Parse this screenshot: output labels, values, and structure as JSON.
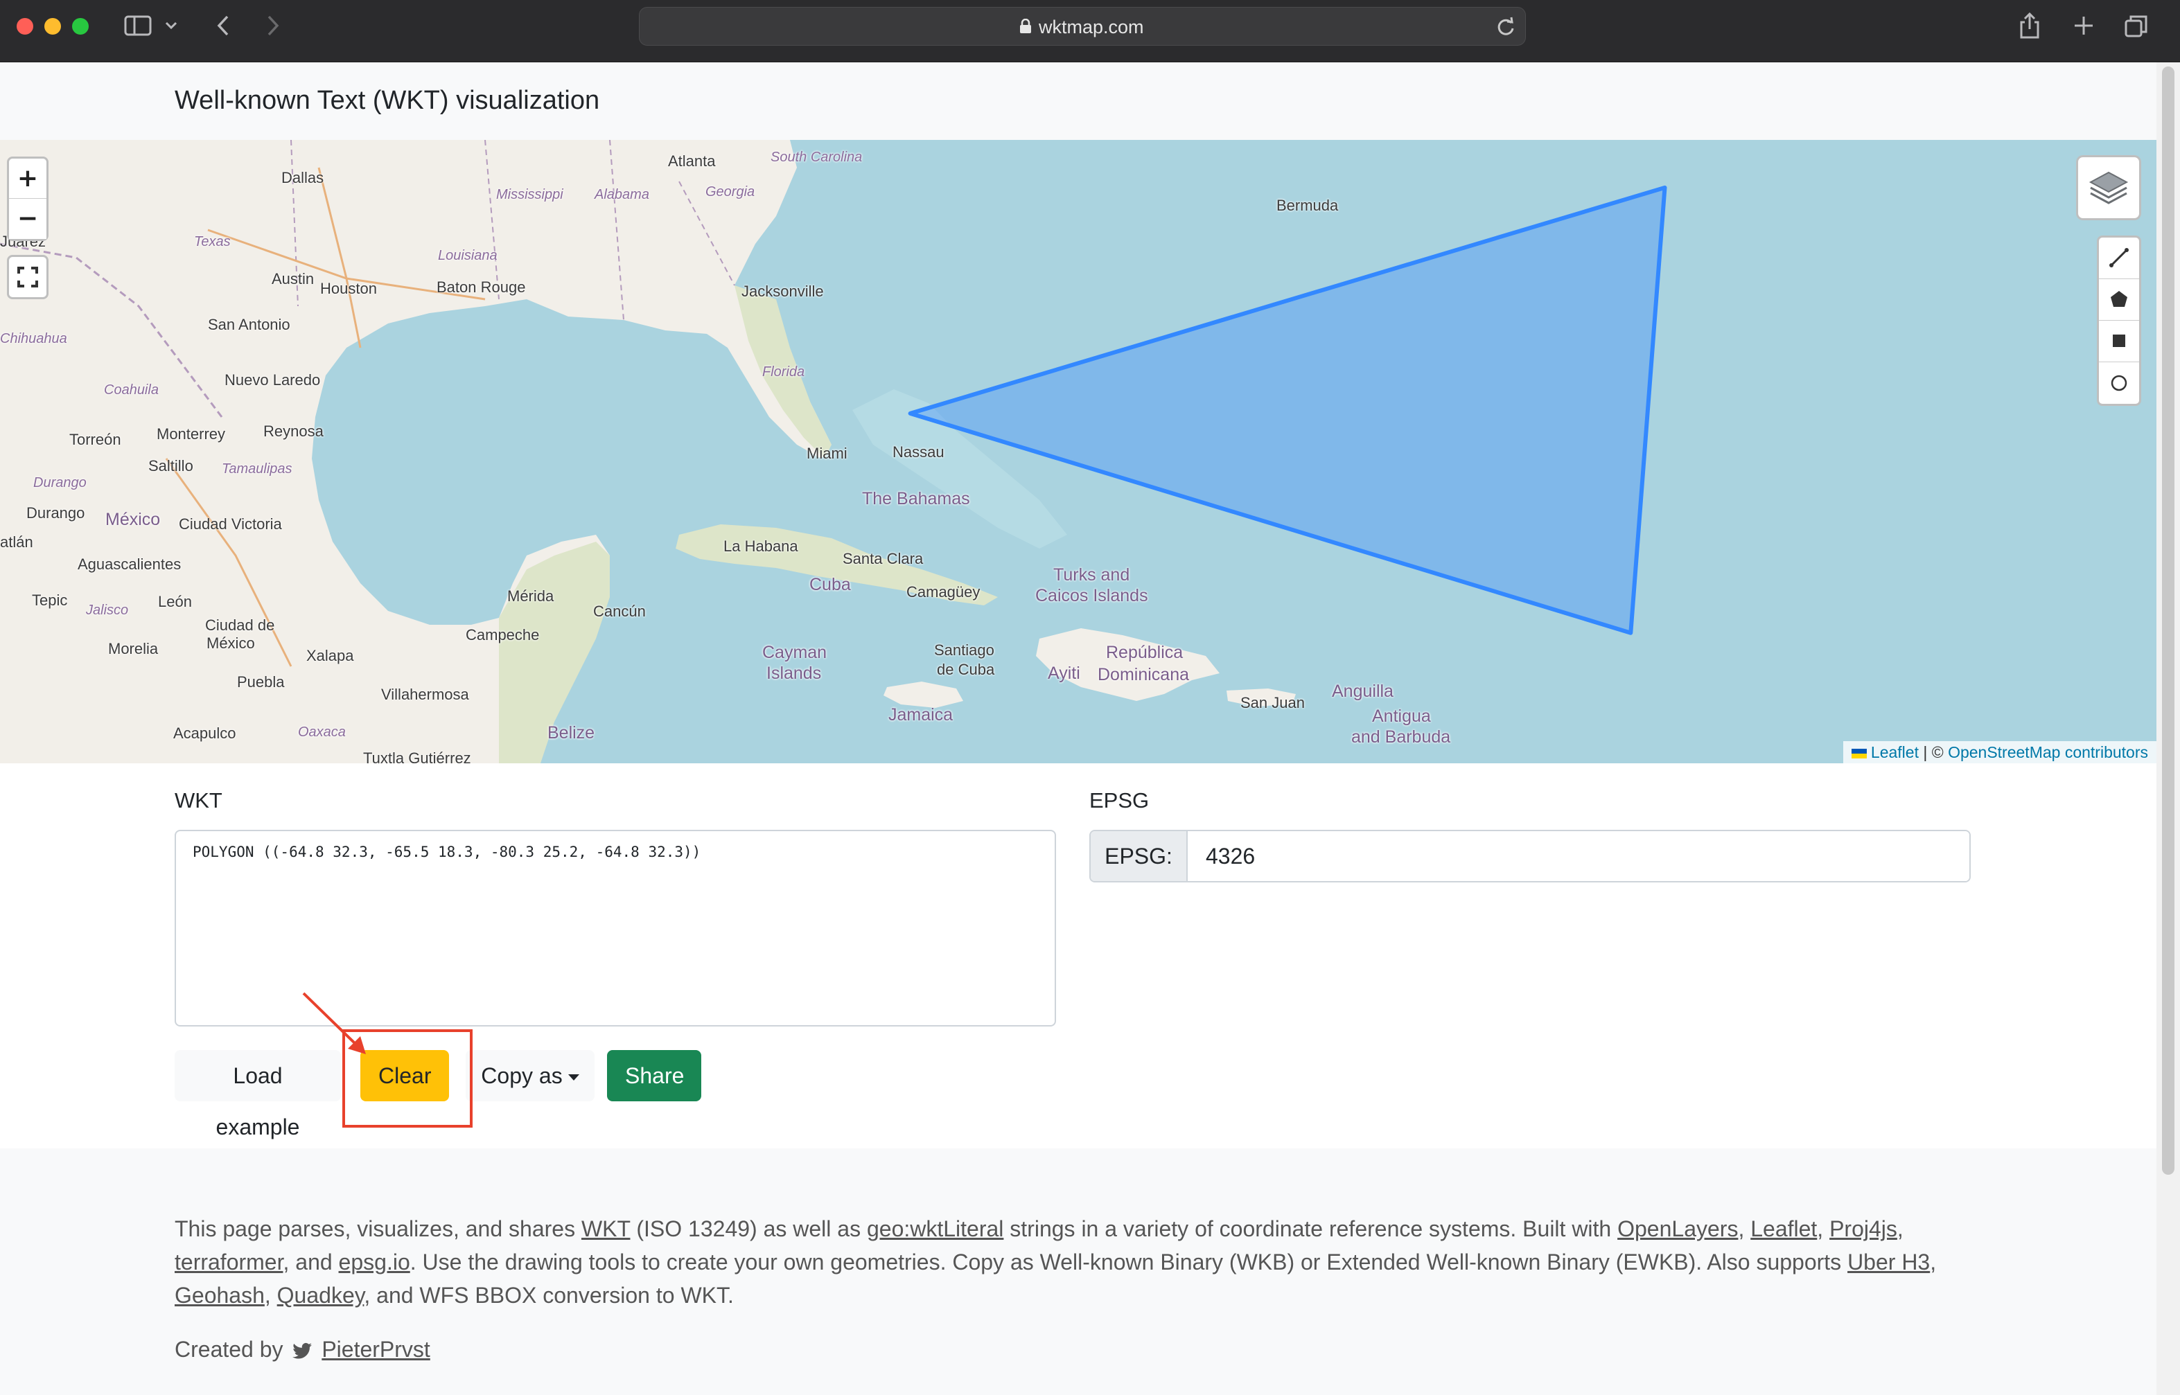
{
  "browser": {
    "url": "wktmap.com"
  },
  "page": {
    "title": "Well-known Text (WKT) visualization"
  },
  "map": {
    "polygon_coordinates_lonlat": [
      [
        -64.8,
        32.3
      ],
      [
        -65.5,
        18.3
      ],
      [
        -80.3,
        25.2
      ],
      [
        -64.8,
        32.3
      ]
    ],
    "polygon_color": "#3388ff",
    "labels": {
      "dallas": "Dallas",
      "atlanta": "Atlanta",
      "south_carolina": "South Carolina",
      "mississippi": "Mississippi",
      "alabama": "Alabama",
      "georgia": "Georgia",
      "bermuda": "Bermuda",
      "juarez": "Juárez",
      "texas": "Texas",
      "austin": "Austin",
      "louisiana": "Louisiana",
      "houston": "Houston",
      "baton_rouge": "Baton Rouge",
      "jacksonville": "Jacksonville",
      "chihuahua": "Chihuahua",
      "san_antonio": "San Antonio",
      "coahuila": "Coahuila",
      "nuevo_laredo": "Nuevo Laredo",
      "florida": "Florida",
      "torreon": "Torreón",
      "monterrey": "Monterrey",
      "reynosa": "Reynosa",
      "saltillo": "Saltillo",
      "tamaulipas": "Tamaulipas",
      "miami": "Miami",
      "nassau": "Nassau",
      "durango_state": "Durango",
      "the_bahamas": "The Bahamas",
      "durango": "Durango",
      "mexico": "México",
      "ciudad_victoria": "Ciudad Victoria",
      "la_habana": "La Habana",
      "mazatlan": "atlán",
      "aguascalientes": "Aguascalientes",
      "santa_clara": "Santa Clara",
      "turks": "Turks and",
      "caicos": "Caicos Islands",
      "cuba": "Cuba",
      "camaguey": "Camagüey",
      "tepic": "Tepic",
      "jalisco": "Jalisco",
      "leon": "León",
      "merida": "Mérida",
      "cancun": "Cancún",
      "ciudad_de": "Ciudad de",
      "mexico_city": "México",
      "campeche": "Campeche",
      "morelia": "Morelia",
      "xalapa": "Xalapa",
      "cayman": "Cayman",
      "islands": "Islands",
      "santiago": "Santiago",
      "de_cuba": "de Cuba",
      "republica": "República",
      "ayiti": "Ayiti",
      "dominicana": "Dominicana",
      "puebla": "Puebla",
      "anguilla": "Anguilla",
      "villahermosa": "Villahermosa",
      "san_juan": "San Juan",
      "antigua": "Antigua",
      "and_barbuda": "and Barbuda",
      "jamaica": "Jamaica",
      "acapulco": "Acapulco",
      "oaxaca": "Oaxaca",
      "belize": "Belize",
      "tuxtla": "Tuxtla Gutiérrez"
    },
    "controls": {
      "zoom_in": "+",
      "zoom_out": "−"
    },
    "attribution": {
      "leaflet": "Leaflet",
      "separator": "| ©",
      "osm": "OpenStreetMap contributors"
    }
  },
  "form": {
    "wkt_label": "WKT",
    "wkt_value": "POLYGON ((-64.8 32.3, -65.5 18.3, -80.3 25.2, -64.8 32.3))",
    "epsg_label": "EPSG",
    "epsg_prefix": "EPSG:",
    "epsg_value": "4326",
    "buttons": {
      "load_example": "Load example",
      "clear": "Clear",
      "copy_as": "Copy as",
      "share": "Share"
    }
  },
  "footer": {
    "p1": "This page parses, visualizes, and shares ",
    "wkt_link": "WKT",
    "p2": " (ISO 13249) as well as ",
    "geo_link": "geo:wktLiteral",
    "p3": " strings in a variety of coordinate reference systems. Built with ",
    "openlayers_link": "OpenLayers",
    "comma1": ", ",
    "leaflet_link": "Leaflet",
    "comma2": ", ",
    "proj4js_link": "Proj4js",
    "comma3": ", ",
    "terraformer_link": "terraformer",
    "and": ", and ",
    "epsgio_link": "epsg.io",
    "p4": ". Use the drawing tools to create your own geometries. Copy as Well-known Binary (WKB) or Extended Well-known Binary (EWKB). Also supports ",
    "h3_link": "Uber H3",
    "comma4": ", ",
    "geohash_link": "Geohash",
    "comma5": ", ",
    "quadkey_link": "Quadkey",
    "p5": ", and WFS BBOX conversion to WKT.",
    "created_by": "Created by",
    "author": "PieterPrvst"
  },
  "colors": {
    "clear_button": "#ffc107",
    "share_button": "#198754",
    "annotation": "#e8412c"
  }
}
